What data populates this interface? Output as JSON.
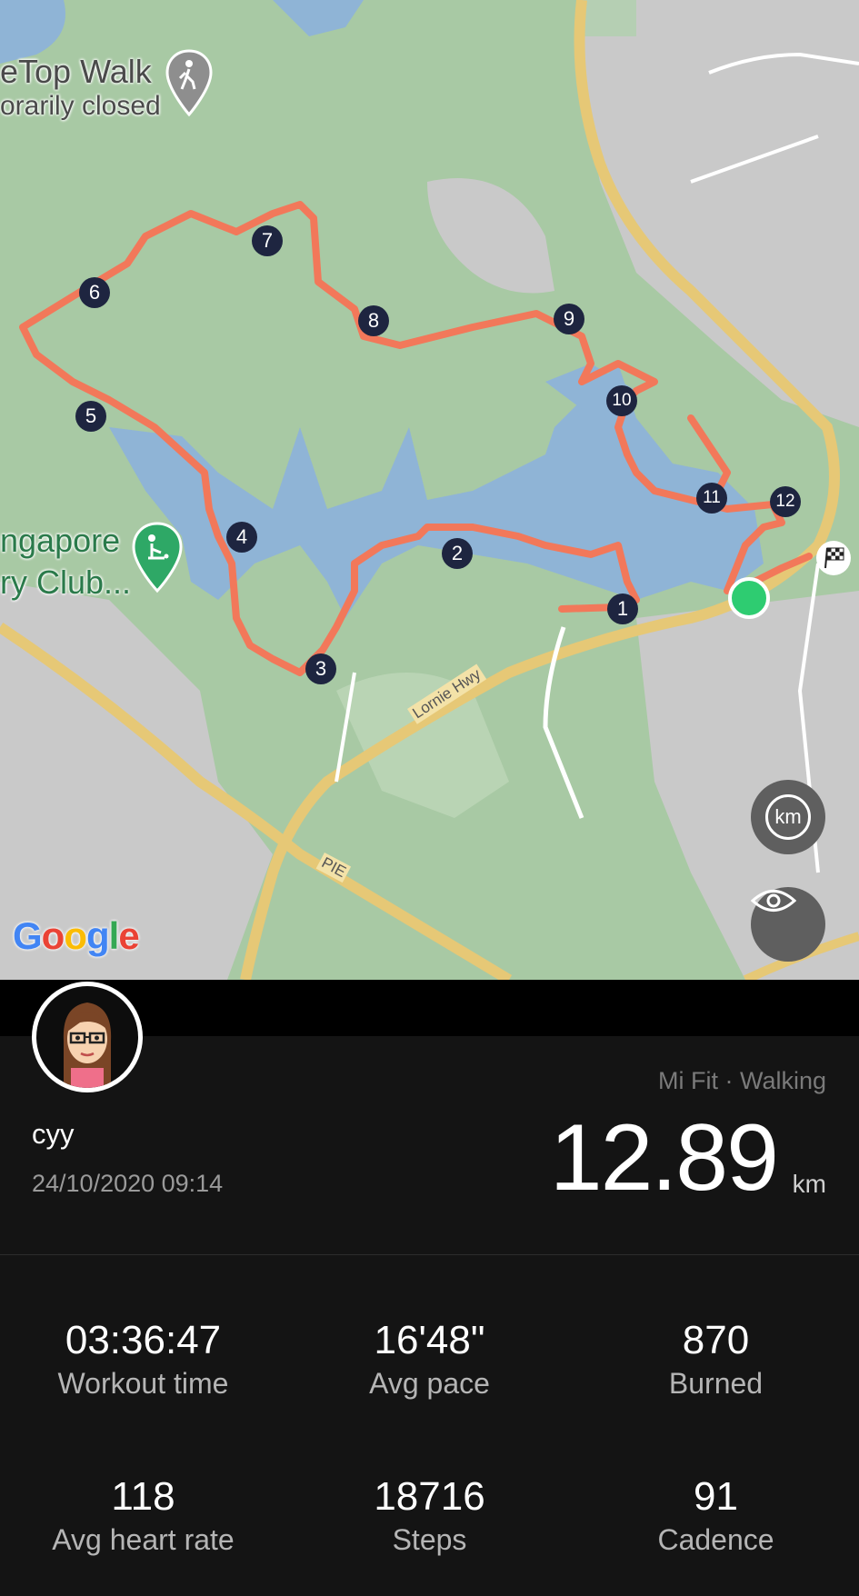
{
  "map": {
    "labels": {
      "poi_walk_line1": "eTop Walk",
      "poi_walk_line2": "orarily closed",
      "poi_club_line1": "ngapore",
      "poi_club_line2": "ry Club...",
      "road_lornie": "Lornie Hwy",
      "road_pie": "PIE"
    },
    "km_markers": [
      "1",
      "2",
      "3",
      "4",
      "5",
      "6",
      "7",
      "8",
      "9",
      "10",
      "11",
      "12"
    ],
    "unit_toggle_label": "km",
    "attribution": "Google",
    "colors": {
      "land": "#a8c9a4",
      "urban": "#c8c8c8",
      "water": "#8fb4d6",
      "road": "#e6c876",
      "route": "#f2785a",
      "start_marker": "#2ecc71",
      "km_marker": "#1e2540"
    },
    "icons": [
      "hiking-pin-icon",
      "golf-pin-icon",
      "finish-flag-icon",
      "start-point-icon",
      "unit-toggle-icon",
      "eye-icon",
      "avatar-icon"
    ]
  },
  "workout": {
    "source": "Mi Fit · Walking",
    "user": "cyy",
    "datetime": "24/10/2020 09:14",
    "distance": "12.89",
    "distance_unit": "km"
  },
  "stats": [
    {
      "value": "03:36:47",
      "label": "Workout time"
    },
    {
      "value": "16'48\"",
      "label": "Avg pace"
    },
    {
      "value": "870",
      "label": "Burned"
    },
    {
      "value": "118",
      "label": "Avg heart rate"
    },
    {
      "value": "18716",
      "label": "Steps"
    },
    {
      "value": "91",
      "label": "Cadence"
    }
  ]
}
